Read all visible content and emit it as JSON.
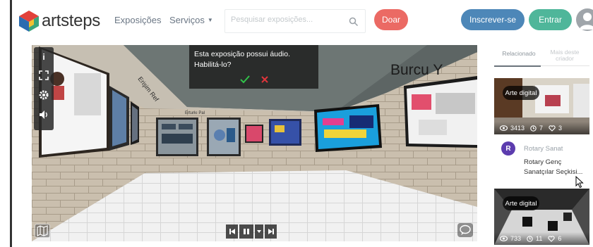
{
  "header": {
    "logo_text": "artsteps",
    "nav": {
      "exposicoes": "Exposições",
      "servicos": "Serviços"
    },
    "search_placeholder": "Pesquisar exposições...",
    "buttons": {
      "doar": "Doar",
      "inscrever": "Inscrever-se",
      "entrar": "Entrar"
    }
  },
  "viewer": {
    "audio_prompt": "Esta exposição possui áudio. Habilitá-lo?",
    "wall_text": "Burcu Y"
  },
  "sidebar": {
    "tabs": {
      "relacionado": "Relacionado",
      "more_from_creator": "Mais deste criador"
    },
    "cards": [
      {
        "badge": "Arte digital",
        "views": "3413",
        "time": "7",
        "likes": "3",
        "author_initial": "R",
        "author": "Rotary Sanat",
        "title": "Rotary Genç Sanatçılar Seçkisi..."
      },
      {
        "badge": "Arte digital",
        "views": "733",
        "time": "11",
        "likes": "6"
      }
    ]
  },
  "colors": {
    "doar": "#eb6a64",
    "inscrever": "#4d87b8",
    "entrar": "#4fb69a",
    "author_avatar": "#5c3cae",
    "confirm": "#31c24a",
    "cancel": "#e0353b"
  }
}
